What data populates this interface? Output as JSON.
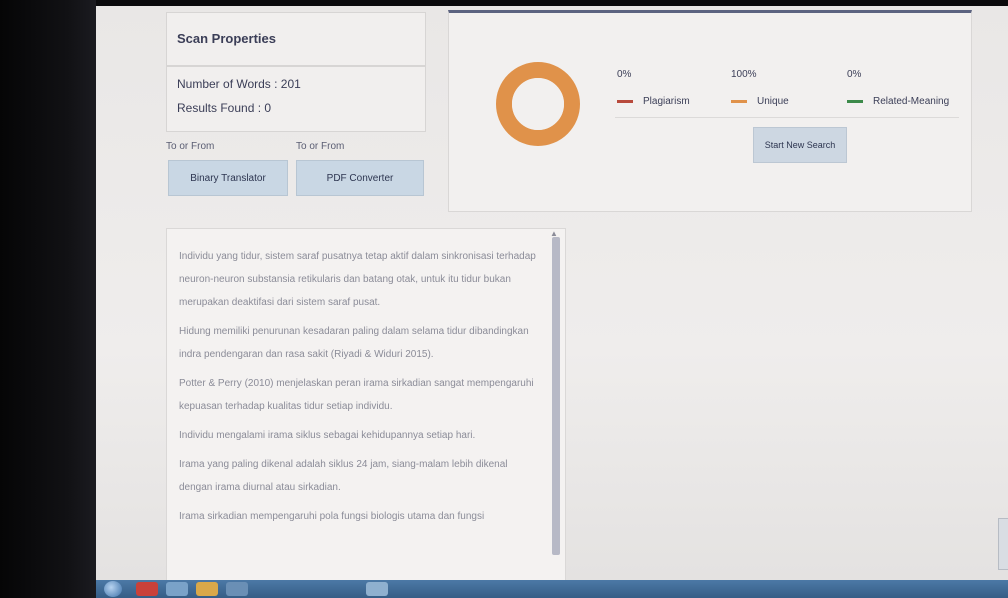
{
  "scan": {
    "title": "Scan Properties",
    "words_label": "Number of Words : 201",
    "results_label": "Results Found : 0"
  },
  "tools": [
    {
      "label": "To or From",
      "button": "Binary Translator"
    },
    {
      "label": "To or From",
      "button": "PDF Converter"
    }
  ],
  "results": {
    "metrics": [
      {
        "percent": "0%",
        "name": "Plagiarism",
        "color": "#b84a3c",
        "value": 0
      },
      {
        "percent": "100%",
        "name": "Unique",
        "color": "#e0924a",
        "value": 100
      },
      {
        "percent": "0%",
        "name": "Related-Meaning",
        "color": "#3c8a4a",
        "value": 0
      }
    ],
    "new_search": "Start New Search"
  },
  "text": {
    "paragraphs": [
      "Individu yang tidur, sistem saraf pusatnya tetap aktif dalam sinkronisasi terhadap neuron-neuron substansia retikularis dan batang otak, untuk itu tidur bukan merupakan deaktifasi dari sistem saraf pusat.",
      "Hidung memiliki penurunan kesadaran paling dalam selama tidur dibandingkan indra pendengaran dan rasa sakit (Riyadi & Widuri 2015).",
      "Potter & Perry (2010) menjelaskan peran irama sirkadian sangat mempengaruhi kepuasan terhadap kualitas tidur setiap individu.",
      "Individu mengalami irama siklus sebagai kehidupannya setiap hari.",
      "Irama yang paling dikenal adalah siklus 24 jam, siang-malam lebih dikenal dengan irama diurnal atau sirkadian.",
      "Irama sirkadian mempengaruhi pola fungsi biologis utama dan fungsi"
    ]
  },
  "colors": {
    "donut": "#e0924a",
    "accent": "#5c6380"
  }
}
